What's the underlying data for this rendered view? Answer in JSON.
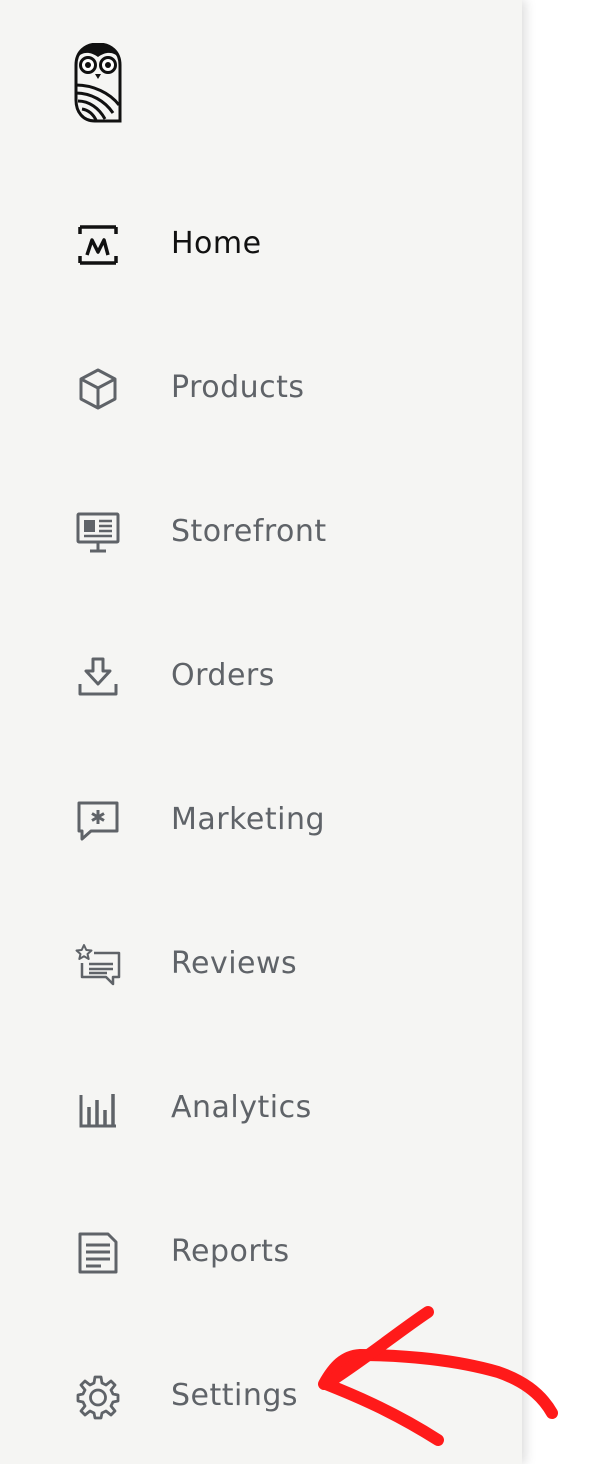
{
  "brand": {
    "logo_icon": "owl-logo-icon"
  },
  "sidebar": {
    "items": [
      {
        "label": "Home",
        "icon": "home-monitor-icon",
        "active": true
      },
      {
        "label": "Products",
        "icon": "box-icon",
        "active": false
      },
      {
        "label": "Storefront",
        "icon": "storefront-display-icon",
        "active": false
      },
      {
        "label": "Orders",
        "icon": "download-tray-icon",
        "active": false
      },
      {
        "label": "Marketing",
        "icon": "chat-asterisk-icon",
        "active": false
      },
      {
        "label": "Reviews",
        "icon": "review-star-icon",
        "active": false
      },
      {
        "label": "Analytics",
        "icon": "bar-chart-icon",
        "active": false
      },
      {
        "label": "Reports",
        "icon": "report-document-icon",
        "active": false
      },
      {
        "label": "Settings",
        "icon": "gear-icon",
        "active": false
      }
    ]
  },
  "colors": {
    "sidebar_bg": "#f5f5f3",
    "active_text": "#111111",
    "inactive_text": "#5f6368",
    "icon_stroke": "#5f6368",
    "annotation_arrow": "#ff0000"
  }
}
